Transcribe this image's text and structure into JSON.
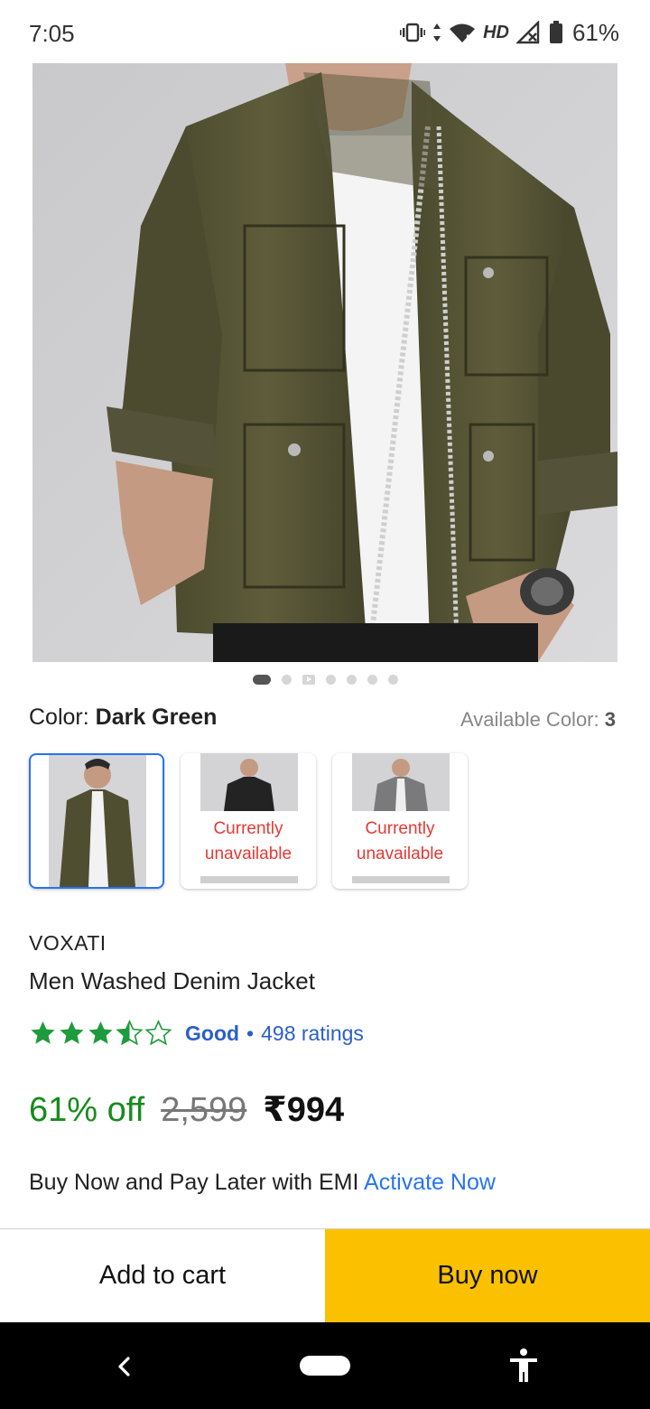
{
  "status_bar": {
    "time": "7:05",
    "network_label": "HD",
    "battery_percent": "61%",
    "icons": [
      "vibrate-icon",
      "data-arrows-icon",
      "wifi-icon",
      "signal-icon",
      "battery-icon"
    ]
  },
  "product_image": {
    "alt_description": "model-wearing-dark-green-jacket"
  },
  "carousel": {
    "total_slides": 7,
    "active_index": 0,
    "video_slide_index": 2
  },
  "color": {
    "label": "Color:",
    "selected": "Dark Green",
    "available_label": "Available Color:",
    "available_count": "3",
    "swatches": [
      {
        "name": "dark-green",
        "selected": true,
        "status": ""
      },
      {
        "name": "black",
        "selected": false,
        "status": "Currently unavailable"
      },
      {
        "name": "grey",
        "selected": false,
        "status": "Currently unavailable"
      }
    ]
  },
  "product": {
    "brand": "VOXATI",
    "title": "Men Washed Denim Jacket",
    "rating_stars": 3.5,
    "rating_word": "Good",
    "rating_separator": "•",
    "rating_count": "498 ratings",
    "discount": "61% off",
    "mrp": "2,599",
    "price": "₹994"
  },
  "emi": {
    "text": "Buy Now and Pay Later with EMI",
    "link": "Activate Now"
  },
  "actions": {
    "add_to_cart": "Add to cart",
    "buy_now": "Buy now"
  },
  "colors": {
    "accent_blue": "#2874f0",
    "rating_blue": "#2b5ec8",
    "discount_green": "#178b1c",
    "star_green": "#1e9b3c",
    "buy_yellow": "#fbc100",
    "unavailable_red": "#e53935"
  }
}
